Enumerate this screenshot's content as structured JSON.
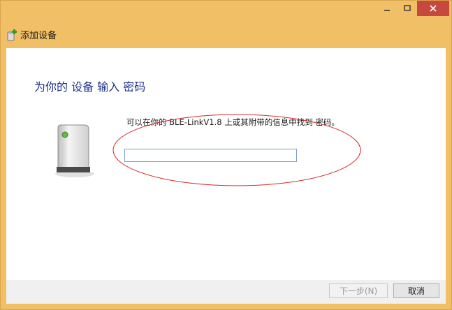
{
  "window": {
    "controls": {
      "minimize_icon": "minimize-icon",
      "maximize_icon": "maximize-icon",
      "close_icon": "close-icon"
    }
  },
  "nav": {
    "title": "添加设备",
    "icon": "add-device-icon"
  },
  "main": {
    "heading": "为你的 设备 输入 密码",
    "device_icon": "device-icon",
    "instruction": "可以在你的 BLE-LinkV1.8 上或其附带的信息中找到 密码。",
    "passcode": {
      "value": "",
      "placeholder": ""
    }
  },
  "footer": {
    "next_label": "下一步(N)",
    "cancel_label": "取消"
  },
  "colors": {
    "accent_frame": "#f0bf66",
    "heading": "#1e3287",
    "close": "#c7483c",
    "annotation": "#d62828"
  }
}
